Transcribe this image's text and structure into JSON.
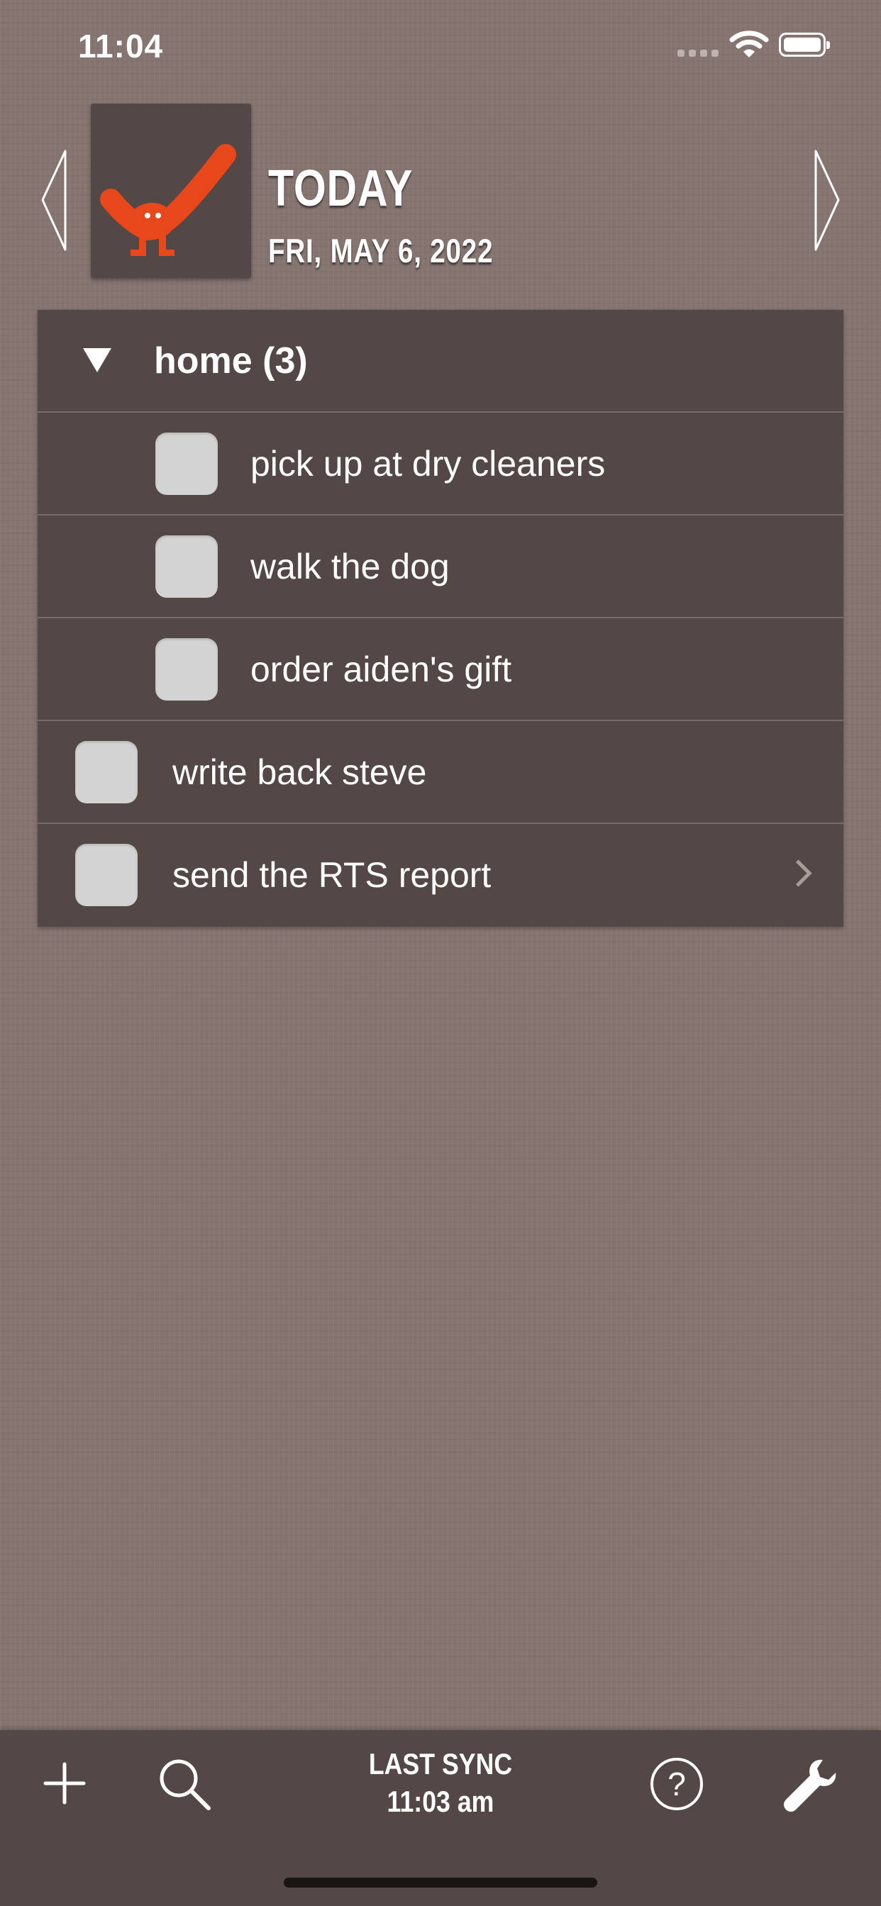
{
  "status_bar": {
    "time": "11:04"
  },
  "header": {
    "title": "TODAY",
    "date": "FRI, MAY 6, 2022",
    "brand_color": "#E8471B"
  },
  "group": {
    "label": "home (3)",
    "expanded": true
  },
  "tasks": [
    {
      "label": "pick up at dry cleaners",
      "checked": false,
      "in_group": true
    },
    {
      "label": "walk the dog",
      "checked": false,
      "in_group": true
    },
    {
      "label": "order aiden's gift",
      "checked": false,
      "in_group": true
    },
    {
      "label": "write back steve",
      "checked": false,
      "in_group": false
    },
    {
      "label": "send the RTS report",
      "checked": false,
      "in_group": false,
      "has_detail": true
    }
  ],
  "toolbar": {
    "sync_line1": "LAST SYNC",
    "sync_line2": "11:03 am",
    "icons": [
      "plus-icon",
      "search-icon",
      "help-icon",
      "wrench-icon"
    ]
  }
}
